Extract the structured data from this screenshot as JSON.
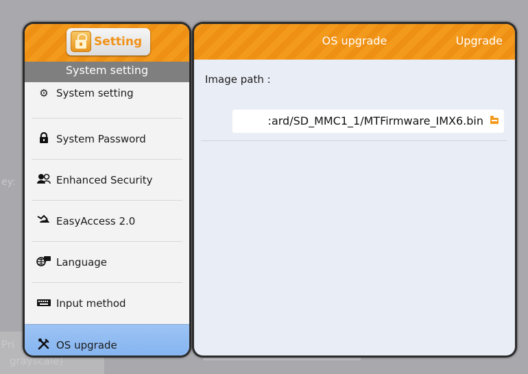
{
  "background": {
    "fragment_1": "ey:",
    "fragment_2": "Pri",
    "fragment_3": "grayscale)"
  },
  "left_panel": {
    "setting_button_label": "Setting",
    "sub_header_title": "System setting",
    "menu_items": [
      {
        "label": "System setting",
        "icon": "gear-icon"
      },
      {
        "label": "System Password",
        "icon": "lock-icon"
      },
      {
        "label": "Enhanced Security",
        "icon": "users-icon"
      },
      {
        "label": "EasyAccess 2.0",
        "icon": "network-icon"
      },
      {
        "label": "Language",
        "icon": "globe-icon"
      },
      {
        "label": "Input method",
        "icon": "keyboard-icon"
      },
      {
        "label": "OS upgrade",
        "icon": "tools-icon",
        "selected": true
      }
    ]
  },
  "right_panel": {
    "title": "OS upgrade",
    "upgrade_button": "Upgrade",
    "image_path_label": "Image path :",
    "image_path_value": ":ard/SD_MMC1_1/MTFirmware_IMX6.bin"
  },
  "colors": {
    "accent_orange": "#F39A1D",
    "selected_blue": "#8DB9F2"
  }
}
